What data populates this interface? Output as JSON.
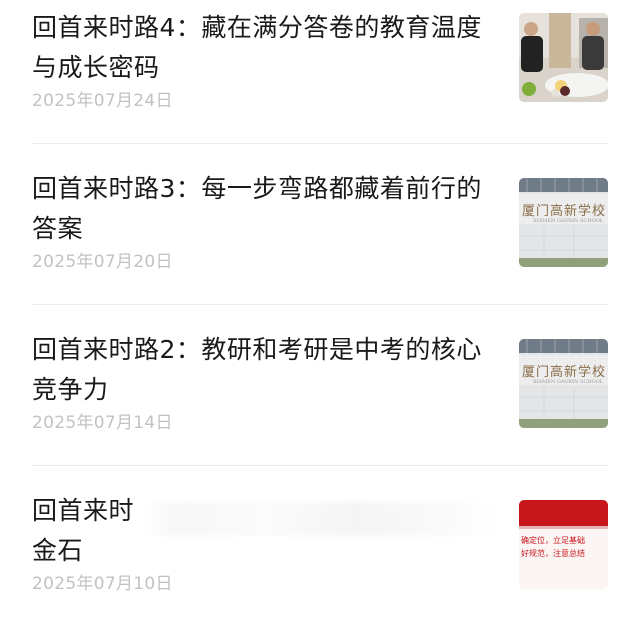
{
  "articles": [
    {
      "title": "回首来时路4：藏在满分答卷的教育温度与成长密码",
      "date": "2025年07月24日",
      "thumbnail": "photo-two-men-at-table"
    },
    {
      "title": "回首来时路3：每一步弯路都藏着前行的答案",
      "date": "2025年07月20日",
      "thumbnail": "school-sign-photo",
      "sign_text": "厦门高新学校",
      "sign_subtext": "XIAMEN GAOXIN SCHOOL"
    },
    {
      "title": "回首来时路2：教研和考研是中考的核心竞争力",
      "date": "2025年07月14日",
      "thumbnail": "school-sign-photo",
      "sign_text": "厦门高新学校",
      "sign_subtext": "XIAMEN GAOXIN SCHOOL"
    },
    {
      "title_visible_start": "回首来时",
      "title_visible_end": "金石",
      "date": "2025年07月10日",
      "thumbnail": "red-banner-slide",
      "banner_line1": "确定位，立足基础",
      "banner_line2": "好规范，注意总结"
    }
  ],
  "colors": {
    "title": "#1a1a1a",
    "date": "#c2c2c2",
    "divider": "#ececec",
    "banner_red": "#c8161d"
  }
}
